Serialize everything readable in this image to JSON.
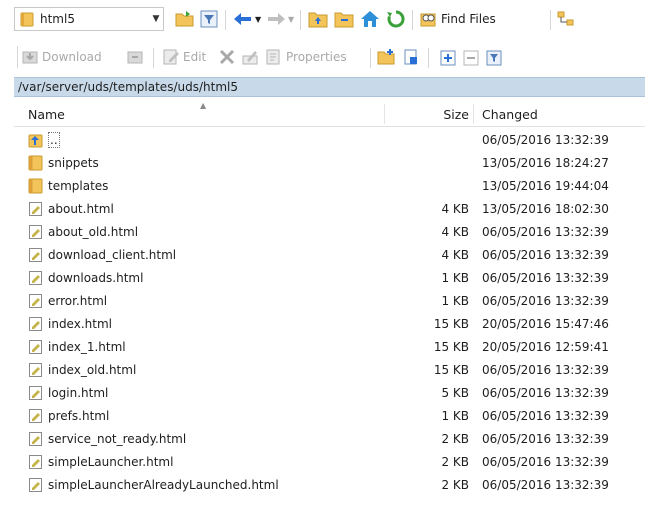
{
  "toolbar": {
    "location_combo_value": "html5",
    "find_files_label": "Find Files"
  },
  "toolbar2": {
    "download_label": "Download",
    "edit_label": "Edit",
    "properties_label": "Properties"
  },
  "path": "/var/server/uds/templates/uds/html5",
  "columns": {
    "name": "Name",
    "size": "Size",
    "changed": "Changed"
  },
  "files": [
    {
      "name": "..",
      "size": "",
      "changed": "06/05/2016 13:32:39",
      "type": "parent"
    },
    {
      "name": "snippets",
      "size": "",
      "changed": "13/05/2016 18:24:27",
      "type": "folder"
    },
    {
      "name": "templates",
      "size": "",
      "changed": "13/05/2016 19:44:04",
      "type": "folder"
    },
    {
      "name": "about.html",
      "size": "4 KB",
      "changed": "13/05/2016 18:02:30",
      "type": "file"
    },
    {
      "name": "about_old.html",
      "size": "4 KB",
      "changed": "06/05/2016 13:32:39",
      "type": "file"
    },
    {
      "name": "download_client.html",
      "size": "4 KB",
      "changed": "06/05/2016 13:32:39",
      "type": "file"
    },
    {
      "name": "downloads.html",
      "size": "1 KB",
      "changed": "06/05/2016 13:32:39",
      "type": "file"
    },
    {
      "name": "error.html",
      "size": "1 KB",
      "changed": "06/05/2016 13:32:39",
      "type": "file"
    },
    {
      "name": "index.html",
      "size": "15 KB",
      "changed": "20/05/2016 15:47:46",
      "type": "file"
    },
    {
      "name": "index_1.html",
      "size": "15 KB",
      "changed": "20/05/2016 12:59:41",
      "type": "file"
    },
    {
      "name": "index_old.html",
      "size": "15 KB",
      "changed": "06/05/2016 13:32:39",
      "type": "file"
    },
    {
      "name": "login.html",
      "size": "5 KB",
      "changed": "06/05/2016 13:32:39",
      "type": "file"
    },
    {
      "name": "prefs.html",
      "size": "1 KB",
      "changed": "06/05/2016 13:32:39",
      "type": "file"
    },
    {
      "name": "service_not_ready.html",
      "size": "2 KB",
      "changed": "06/05/2016 13:32:39",
      "type": "file"
    },
    {
      "name": "simpleLauncher.html",
      "size": "2 KB",
      "changed": "06/05/2016 13:32:39",
      "type": "file"
    },
    {
      "name": "simpleLauncherAlreadyLaunched.html",
      "size": "2 KB",
      "changed": "06/05/2016 13:32:39",
      "type": "file"
    }
  ],
  "colors": {
    "path_bar": "#c8daea",
    "folder": "#f2c45a",
    "nav_arrow": "#2a6fd6",
    "home": "#2c8fd8",
    "refresh": "#3aa03a"
  }
}
